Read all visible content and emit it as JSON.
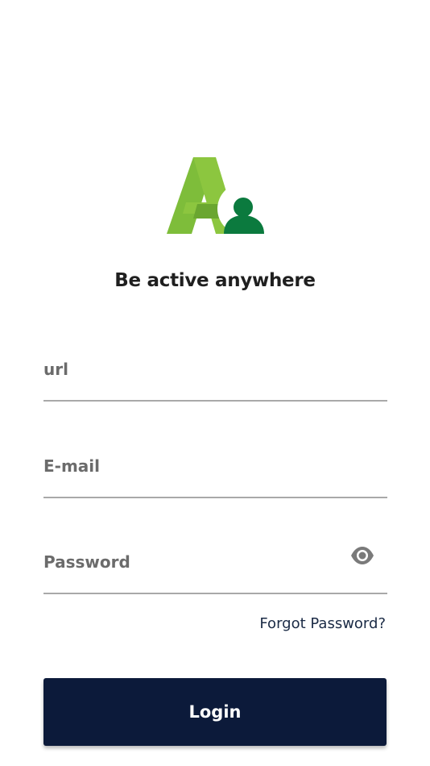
{
  "app": {
    "tagline": "Be active anywhere",
    "logo_icon": "app-logo-a-person"
  },
  "form": {
    "url": {
      "placeholder": "url",
      "value": ""
    },
    "email": {
      "placeholder": "E-mail",
      "value": ""
    },
    "password": {
      "placeholder": "Password",
      "value": "",
      "toggle_icon": "eye-icon"
    },
    "forgot_password_label": "Forgot Password?",
    "login_label": "Login"
  },
  "colors": {
    "logo_green_light": "#8cc63f",
    "logo_green_dark": "#0b7a3e",
    "primary_button": "#0c1a3a",
    "field_text": "#6b6b6b",
    "link_text": "#1a2a45"
  }
}
